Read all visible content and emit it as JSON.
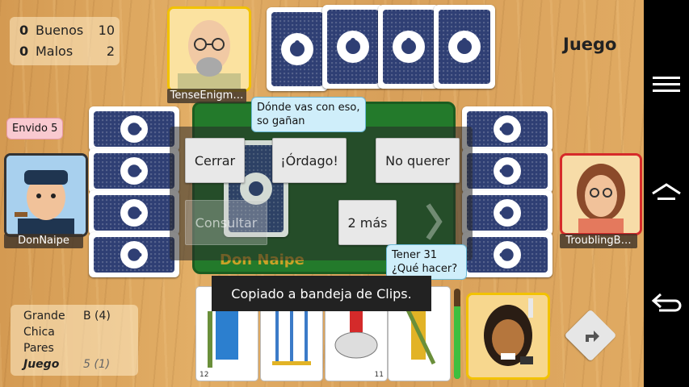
{
  "score": {
    "rows": [
      {
        "num": "0",
        "team": "Buenos",
        "value": "10"
      },
      {
        "num": "0",
        "team": "Malos",
        "value": "2"
      }
    ]
  },
  "phase_title": "Juego",
  "players": {
    "top": {
      "name": "TenseEnigm…"
    },
    "left": {
      "name": "DonNaipe"
    },
    "right": {
      "name": "TroublingB…"
    }
  },
  "bubbles": {
    "top": "Dónde vas con eso, so gañan",
    "left": "Envido 5",
    "bottom": "Tener 31 ¿Qué hacer?"
  },
  "actions": {
    "close": "Cerrar",
    "ordago": "¡Órdago!",
    "no_quiero": "No querer",
    "consult": "Consultar",
    "two_more": "2 más"
  },
  "brand": "Don Naipe",
  "toast": "Copiado a bandeja de Clips.",
  "lances": {
    "rows": [
      {
        "label": "Grande",
        "value": "B (4)"
      },
      {
        "label": "Chica",
        "value": ""
      },
      {
        "label": "Pares",
        "value": ""
      },
      {
        "label": "Juego",
        "value": "5 (1)"
      }
    ]
  },
  "hand": {
    "cards": [
      "rey-bastos",
      "espadas",
      "caballo-oros",
      "sota-bastos"
    ],
    "indices": [
      "12",
      "",
      "11",
      ""
    ]
  },
  "icons": {
    "menu": "menu-icon",
    "home": "home-icon",
    "back": "back-icon",
    "share": "share-icon"
  },
  "colors": {
    "table": "#237a2b",
    "card_back": "#2f3f74",
    "active_player": "#f2c200",
    "right_player": "#d62a2a"
  }
}
